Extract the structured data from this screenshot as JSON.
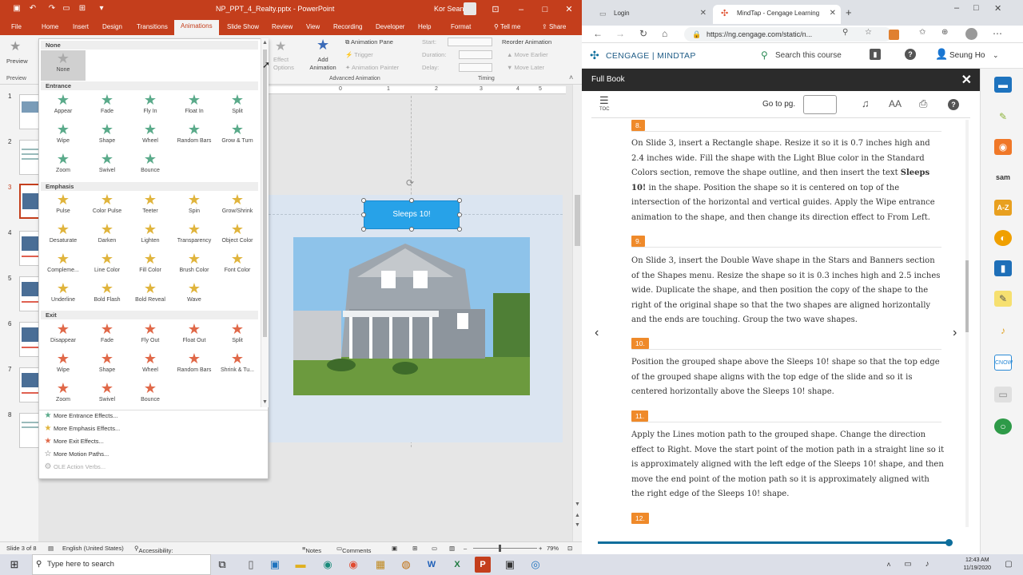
{
  "powerpoint": {
    "file_name": "NP_PPT_4_Realty.pptx",
    "app_name": "PowerPoint",
    "user": "Kor Sean",
    "tabs": [
      "File",
      "Home",
      "Insert",
      "Design",
      "Transitions",
      "Animations",
      "Slide Show",
      "Review",
      "View",
      "Recording",
      "Developer",
      "Help",
      "Format"
    ],
    "active_tab": "Animations",
    "tell_me": "Tell me",
    "share": "Share",
    "ribbon": {
      "preview": "Preview",
      "preview_group": "Preview",
      "effect_options": "Effect Options",
      "add_animation": "Add Animation",
      "animation_pane": "Animation Pane",
      "trigger": "Trigger",
      "animation_painter": "Animation Painter",
      "advanced_group": "Advanced Animation",
      "start": "Start:",
      "duration": "Duration:",
      "delay": "Delay:",
      "timing_group": "Timing",
      "reorder": "Reorder Animation",
      "move_earlier": "Move Earlier",
      "move_later": "Move Later"
    },
    "gallery": {
      "none_header": "None",
      "none_label": "None",
      "entrance_header": "Entrance",
      "entrance": [
        "Appear",
        "Fade",
        "Fly In",
        "Float In",
        "Split",
        "Wipe",
        "Shape",
        "Wheel",
        "Random Bars",
        "Grow & Turn",
        "Zoom",
        "Swivel",
        "Bounce"
      ],
      "emphasis_header": "Emphasis",
      "emphasis": [
        "Pulse",
        "Color Pulse",
        "Teeter",
        "Spin",
        "Grow/Shrink",
        "Desaturate",
        "Darken",
        "Lighten",
        "Transparency",
        "Object Color",
        "Compleme...",
        "Line Color",
        "Fill Color",
        "Brush Color",
        "Font Color",
        "Underline",
        "Bold Flash",
        "Bold Reveal",
        "Wave"
      ],
      "exit_header": "Exit",
      "exit": [
        "Disappear",
        "Fade",
        "Fly Out",
        "Float Out",
        "Split",
        "Wipe",
        "Shape",
        "Wheel",
        "Random Bars",
        "Shrink & Tu...",
        "Zoom",
        "Swivel",
        "Bounce"
      ],
      "more": [
        "More Entrance Effects...",
        "More Emphasis Effects...",
        "More Exit Effects...",
        "More Motion Paths...",
        "OLE Action Verbs..."
      ]
    },
    "slide_numbers": [
      "1",
      "2",
      "3",
      "4",
      "5",
      "6",
      "7",
      "8"
    ],
    "ruler": [
      "0",
      "1",
      "2",
      "3",
      "4",
      "5"
    ],
    "shape_text": "Sleeps 10!",
    "status": {
      "slide": "Slide 3 of 8",
      "language": "English (United States)",
      "accessibility": "Accessibility: Investigate",
      "notes": "Notes",
      "comments": "Comments",
      "zoom": "79%"
    }
  },
  "browser": {
    "tabs": [
      {
        "label": "Login"
      },
      {
        "label": "MindTap - Cengage Learning"
      }
    ],
    "url": "https://ng.cengage.com/static/n...",
    "brand": "CENGAGE | MINDTAP",
    "search": "Search this course",
    "user": "Seung Ho",
    "full_book": "Full Book",
    "toc": "TOC",
    "goto": "Go to pg.",
    "steps": [
      {
        "num": "8.",
        "text": "On Slide 3, insert a Rectangle shape. Resize it so it is 0.7 inches high and 2.4 inches wide. Fill the shape with the Light Blue color in the Standard Colors section, remove the shape outline, and then insert the text Sleeps 10! in the shape. Position the shape so it is centered on top of the intersection of the horizontal and vertical guides. Apply the Wipe entrance animation to the shape, and then change its direction effect to From Left."
      },
      {
        "num": "9.",
        "text": "On Slide 3, insert the Double Wave shape in the Stars and Banners section of the Shapes menu. Resize the shape so it is 0.3 inches high and 2.5 inches wide. Duplicate the shape, and then position the copy of the shape to the right of the original shape so that the two shapes are aligned horizontally and the ends are touching. Group the two wave shapes."
      },
      {
        "num": "10.",
        "text": "Position the grouped shape above the Sleeps 10! shape so that the top edge of the grouped shape aligns with the top edge of the slide and so it is centered horizontally above the Sleeps 10! shape."
      },
      {
        "num": "11.",
        "text": "Apply the Lines motion path to the grouped shape. Change the direction effect to Right. Move the start point of the motion path in a straight line so it is approximately aligned with the left edge of the Sleeps 10! shape, and then move the end point of the motion path so it is approximately aligned with the right edge of the Sleeps 10! shape."
      },
      {
        "num": "12.",
        "text": ""
      }
    ]
  },
  "taskbar": {
    "search": "Type here to search",
    "time": "12:43 AM",
    "date": "11/19/2020"
  }
}
